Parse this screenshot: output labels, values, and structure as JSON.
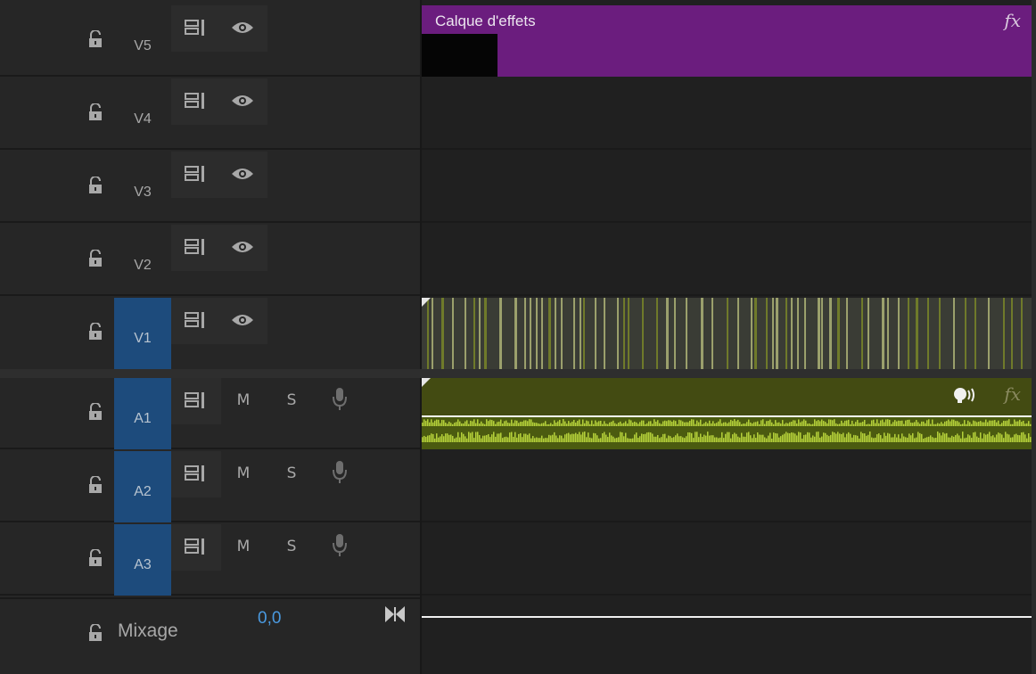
{
  "video_tracks": [
    {
      "id": "V5",
      "label": "V5",
      "selected": false
    },
    {
      "id": "V4",
      "label": "V4",
      "selected": false
    },
    {
      "id": "V3",
      "label": "V3",
      "selected": false
    },
    {
      "id": "V2",
      "label": "V2",
      "selected": false
    },
    {
      "id": "V1",
      "label": "V1",
      "selected": true
    }
  ],
  "audio_tracks": [
    {
      "id": "A1",
      "label": "A1",
      "selected": true,
      "mute_label": "M",
      "solo_label": "S"
    },
    {
      "id": "A2",
      "label": "A2",
      "selected": true,
      "mute_label": "M",
      "solo_label": "S"
    },
    {
      "id": "A3",
      "label": "A3",
      "selected": true,
      "mute_label": "M",
      "solo_label": "S"
    }
  ],
  "mix": {
    "label": "Mixage",
    "value": "0,0"
  },
  "clips": {
    "adjustment_layer": {
      "name": "Calque d'effets",
      "fx_label": "fx",
      "color": "#6b1d7e"
    },
    "video_v1": {
      "color": "#3a3c35",
      "stripe_color": "#9ba06c"
    },
    "audio_a1": {
      "fx_label": "fx",
      "color": "#434b12",
      "waveform_color": "#b5d13a"
    }
  },
  "icons": {
    "lock": "lock-open-icon",
    "sync": "toggle-sync-lock-icon",
    "eye": "eye-icon",
    "mic": "microphone-icon",
    "speaker": "speaker-icon",
    "mix_toggle": "bowtie-icon"
  },
  "colors": {
    "panel_bg": "#262626",
    "selected_track": "#1d4b7c",
    "mix_value": "#4a9ae0"
  }
}
